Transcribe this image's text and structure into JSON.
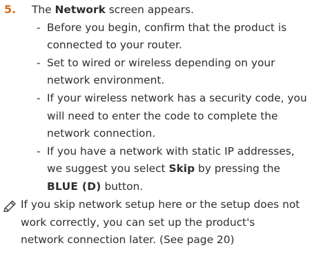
{
  "step": {
    "number": "5.",
    "text_before": "The ",
    "keyword": "Network",
    "text_after": " screen appears."
  },
  "bullets": [
    {
      "dash": "-",
      "text": "Before you begin, confirm that the product is connected to your router."
    },
    {
      "dash": "-",
      "text": "Set to wired or wireless depending on your network environment."
    },
    {
      "dash": "-",
      "text": "If your wireless network has a security code, you will need to enter the code to complete the network connection."
    },
    {
      "dash": "-",
      "text_before": "If you have a network with static IP addresses, we suggest you select ",
      "skip_label": "Skip",
      "text_mid": " by pressing the ",
      "blue_key": "BLUE (D)",
      "text_after": " button."
    }
  ],
  "note": {
    "icon": "pencil-note-icon",
    "text": "If you skip network setup here or the setup does not work correctly, you can set up the product's network connection later. (See page 20)"
  }
}
